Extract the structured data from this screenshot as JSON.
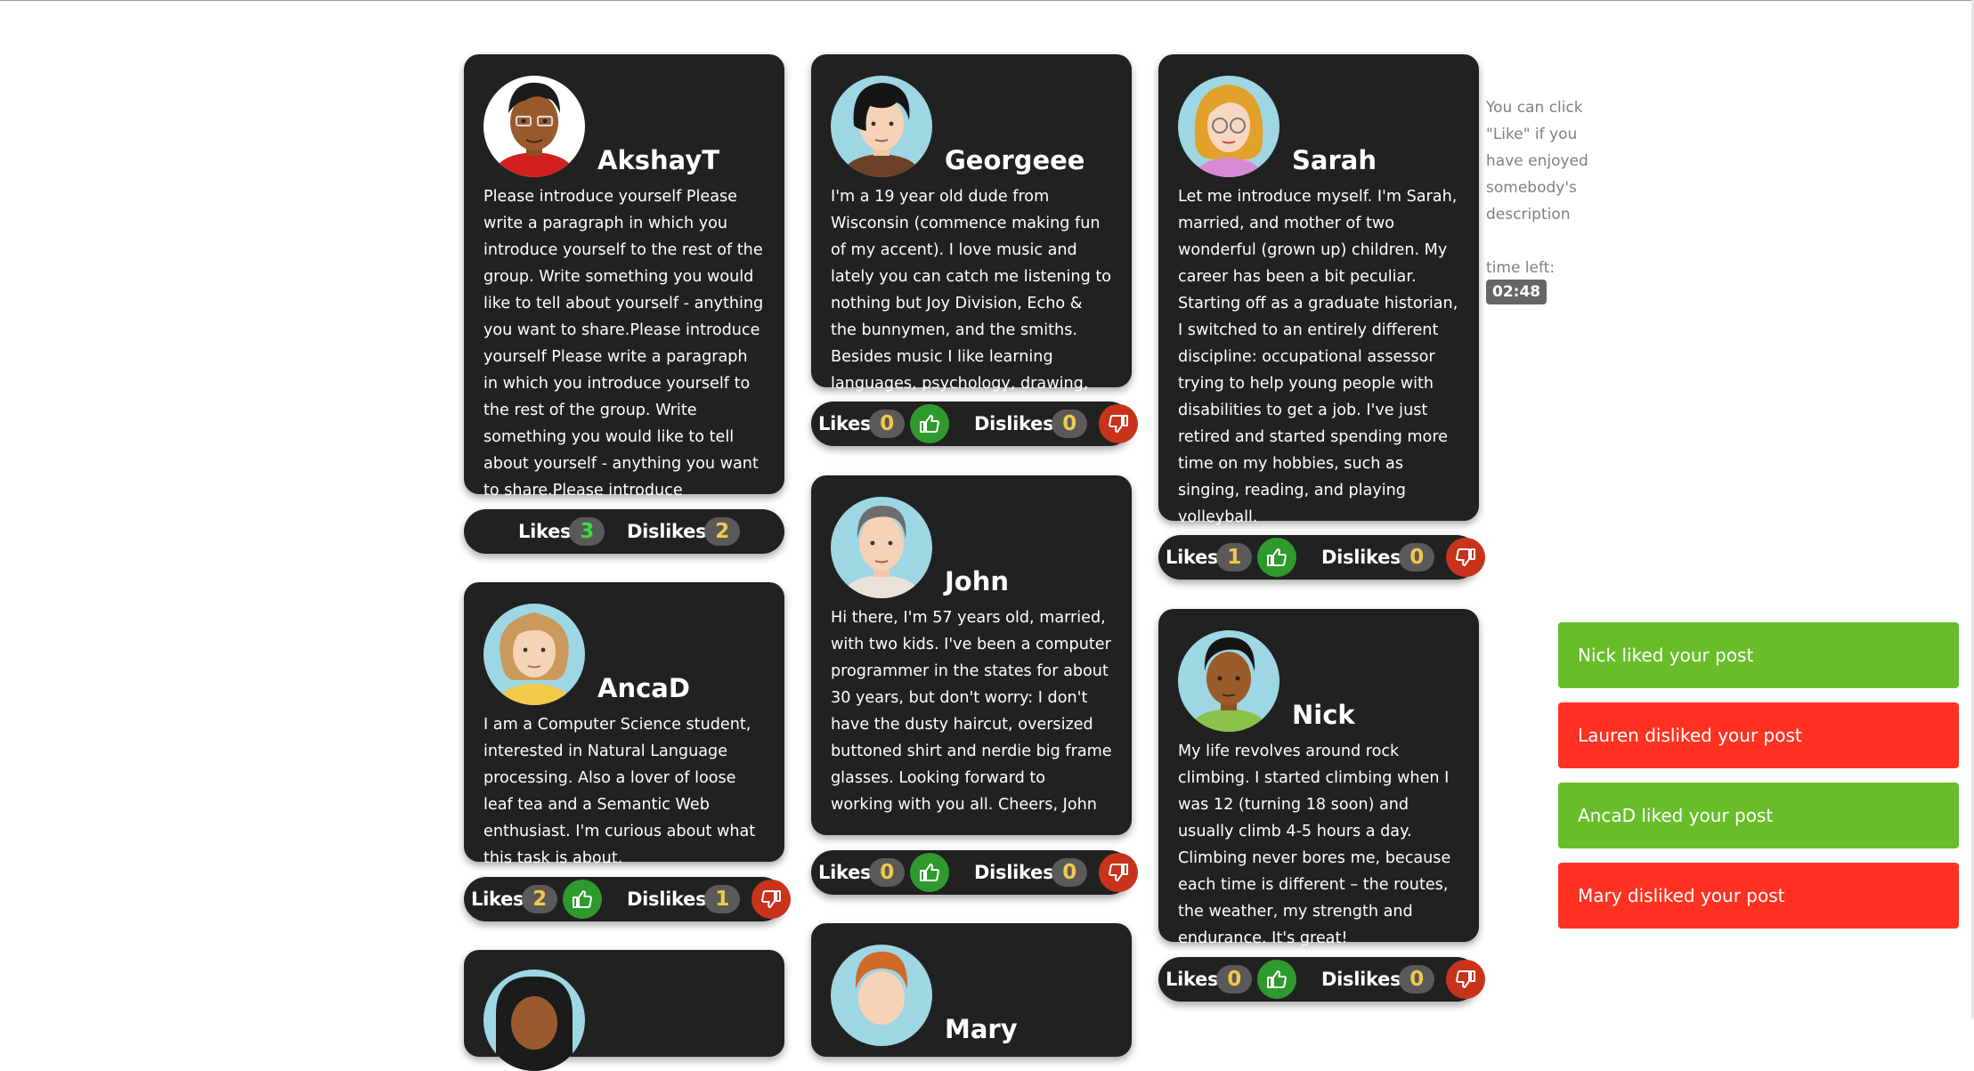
{
  "info": {
    "hint": "You can click \"Like\" if you have enjoyed somebody's description",
    "time_label": "time left:",
    "time_value": "02:48"
  },
  "icons": {
    "like": "thumbs-up-icon",
    "dislike": "thumbs-down-icon"
  },
  "colors": {
    "card": "#212121",
    "like_button": "#2e9a2e",
    "dislike_button": "#c8331c",
    "toast_liked": "#67bd2a",
    "toast_disliked": "#ff3222"
  },
  "labels": {
    "likes": "Likes",
    "dislikes": "Dislikes"
  },
  "profiles": [
    {
      "name": "AkshayT",
      "description": "Please introduce yourself Please write a paragraph in which you introduce yourself to the rest of the group. Write something you would like to tell about yourself - anything you want to share.Please introduce yourself Please write a paragraph in which you introduce yourself to the rest of the group. Write something you would like to tell about yourself - anything you want to share.Please introduce",
      "likes": "3",
      "dislikes": "2"
    },
    {
      "name": "Georgeee",
      "description": "I'm a 19 year old dude from Wisconsin (commence making fun of my accent). I love music and lately you can catch me listening to nothing but Joy Division, Echo & the bunnymen, and the smiths. Besides music I like learning languages, psychology, drawing, and writing.",
      "likes": "0",
      "dislikes": "0"
    },
    {
      "name": "Sarah",
      "description": "Let me introduce myself. I'm Sarah, married, and mother of two wonderful (grown up) children. My career has been a bit peculiar. Starting off as a graduate historian, I switched to an entirely different discipline: occupational assessor trying to help young people with disabilities to get a job. I've just retired and started spending more time on my hobbies, such as singing, reading, and playing volleyball.",
      "likes": "1",
      "dislikes": "0"
    },
    {
      "name": "AncaD",
      "description": "I am a Computer Science student, interested in Natural Language processing. Also a lover of loose leaf tea and a Semantic Web enthusiast. I'm curious about what this task is about.",
      "likes": "2",
      "dislikes": "1"
    },
    {
      "name": "John",
      "description": "Hi there, I'm 57 years old, married, with two kids. I've been a computer programmer in the states for about 30 years, but don't worry: I don't have the dusty haircut, oversized buttoned shirt and nerdie big frame glasses. Looking forward to working with you all. Cheers, John",
      "likes": "0",
      "dislikes": "0"
    },
    {
      "name": "Nick",
      "description": "My life revolves around rock climbing. I started climbing when I was 12 (turning 18 soon) and usually climb 4-5 hours a day. Climbing never bores me, because each time is different – the routes, the weather, my strength and endurance. It's great!",
      "likes": "0",
      "dislikes": "0"
    },
    {
      "name": ""
    },
    {
      "name": "Mary"
    }
  ],
  "notifications": [
    {
      "text": "Nick liked your post",
      "kind": "liked"
    },
    {
      "text": "Lauren disliked your post",
      "kind": "disliked"
    },
    {
      "text": "AncaD liked your post",
      "kind": "liked"
    },
    {
      "text": "Mary disliked your post",
      "kind": "disliked"
    }
  ]
}
